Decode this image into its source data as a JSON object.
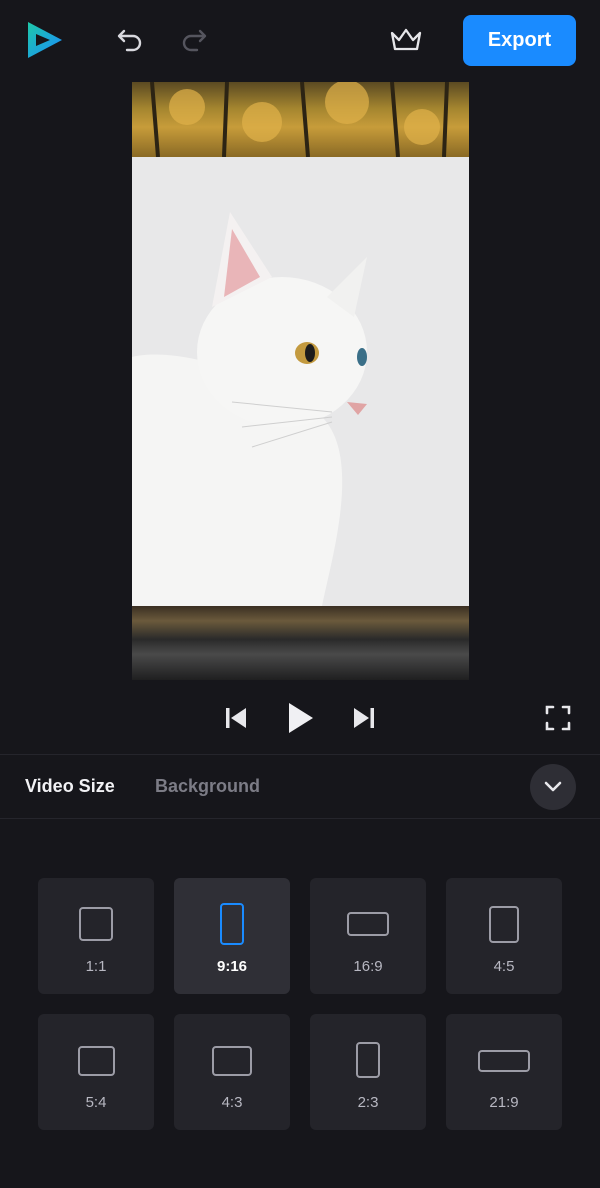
{
  "header": {
    "export_label": "Export",
    "icons": [
      "logo-icon",
      "undo-icon",
      "redo-icon",
      "crown-icon"
    ]
  },
  "preview": {
    "image": "white cat portrait over forest and water background"
  },
  "transport": {
    "icons": [
      "skip-previous-icon",
      "play-icon",
      "skip-next-icon",
      "fullscreen-icon"
    ]
  },
  "tabs": {
    "active": "Video Size",
    "inactive": "Background"
  },
  "sizes": [
    {
      "label": "1:1",
      "selected": false
    },
    {
      "label": "9:16",
      "selected": true
    },
    {
      "label": "16:9",
      "selected": false
    },
    {
      "label": "4:5",
      "selected": false
    },
    {
      "label": "5:4",
      "selected": false
    },
    {
      "label": "4:3",
      "selected": false
    },
    {
      "label": "2:3",
      "selected": false
    },
    {
      "label": "21:9",
      "selected": false
    }
  ],
  "colors": {
    "accent": "#1a8bff",
    "background": "#16161b",
    "tile": "#24242a"
  }
}
